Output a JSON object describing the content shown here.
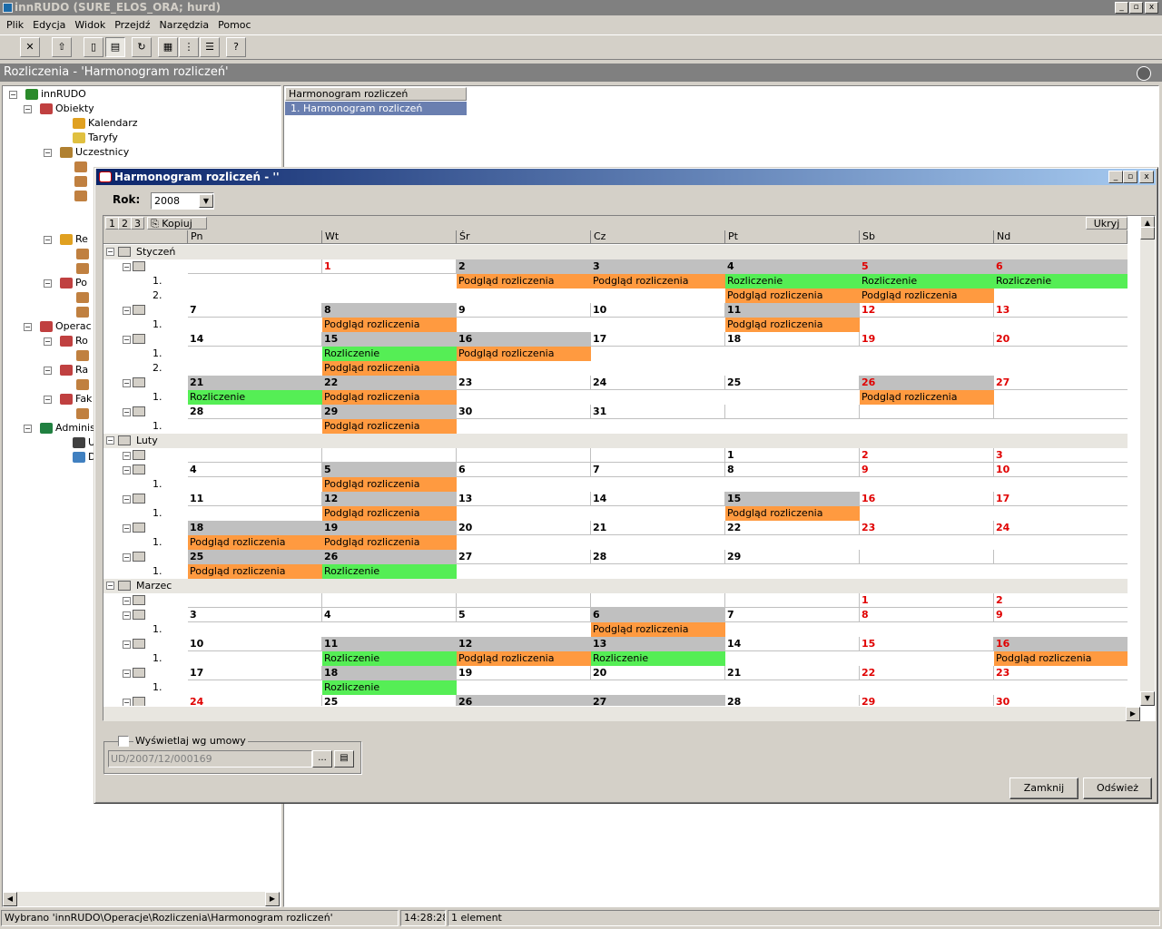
{
  "app": {
    "title": "innRUDO (SURE_ELOS_ORA; hurd)",
    "menu": [
      "Plik",
      "Edycja",
      "Widok",
      "Przejdź",
      "Narzędzia",
      "Pomoc"
    ],
    "section_title": "Rozliczenia - 'Harmonogram rozliczeń'",
    "window_controls": [
      "_",
      "▫",
      "x"
    ]
  },
  "tree": {
    "root": "innRUDO",
    "nodes": [
      {
        "label": "Obiekty",
        "icon": "objects-icon"
      },
      {
        "label": "Kalendarz",
        "icon": "calendar-icon"
      },
      {
        "label": "Taryfy",
        "icon": "tariff-icon"
      },
      {
        "label": "Uczestnicy",
        "icon": "participants-icon"
      },
      {
        "label": "Re",
        "icon": "folder-icon"
      },
      {
        "label": "Po",
        "icon": "folder-icon"
      },
      {
        "label": "Operac",
        "icon": "operations-icon"
      },
      {
        "label": "Ro",
        "icon": "settlement-icon"
      },
      {
        "label": "Ra",
        "icon": "report-icon"
      },
      {
        "label": "Fak",
        "icon": "invoice-icon"
      },
      {
        "label": "Adminis",
        "icon": "admin-icon"
      },
      {
        "label": "Uż",
        "icon": "users-icon"
      },
      {
        "label": "Dzi",
        "icon": "log-icon"
      }
    ]
  },
  "right_list": {
    "header": "Harmonogram rozliczeń",
    "row": "1.  Harmonogram rozliczeń"
  },
  "dialog": {
    "title": "Harmonogram rozliczeń - ''",
    "rok_label": "Rok:",
    "rok_value": "2008",
    "toolbar": [
      "1",
      "2",
      "3",
      "Kopiuj"
    ],
    "hide_label": "Ukryj",
    "columns": [
      "Pn",
      "Wt",
      "Śr",
      "Cz",
      "Pt",
      "Sb",
      "Nd"
    ],
    "show_by_contract": "Wyświetlaj wg umowy",
    "contract_value": "UD/2007/12/000169",
    "browse_label": "...",
    "close_label": "Zamknij",
    "refresh_label": "Odśwież"
  },
  "calendar": {
    "months": [
      {
        "name": "Styczeń",
        "weeks": [
          {
            "days": [
              "",
              "1",
              "2",
              "3",
              "4",
              "5",
              "6"
            ],
            "gray": [
              2,
              3,
              4,
              5,
              6
            ],
            "red": [
              1,
              5,
              6
            ],
            "entries": [
              [
                "",
                "",
                "Podgląd rozliczenia",
                "Podgląd rozliczenia",
                "Rozliczenie",
                "Rozliczenie",
                "Rozliczenie"
              ],
              [
                "",
                "",
                "",
                "",
                "Podgląd rozliczenia",
                "Podgląd rozliczenia",
                ""
              ]
            ]
          },
          {
            "days": [
              "7",
              "8",
              "9",
              "10",
              "11",
              "12",
              "13"
            ],
            "gray": [
              1,
              4
            ],
            "red": [
              5,
              6
            ],
            "entries": [
              [
                "",
                "Podgląd rozliczenia",
                "",
                "",
                "Podgląd rozliczenia",
                "",
                ""
              ]
            ]
          },
          {
            "days": [
              "14",
              "15",
              "16",
              "17",
              "18",
              "19",
              "20"
            ],
            "gray": [
              1,
              2
            ],
            "red": [
              5,
              6
            ],
            "entries": [
              [
                "",
                "Rozliczenie",
                "Podgląd rozliczenia",
                "",
                "",
                "",
                ""
              ],
              [
                "",
                "Podgląd rozliczenia",
                "",
                "",
                "",
                "",
                ""
              ]
            ]
          },
          {
            "days": [
              "21",
              "22",
              "23",
              "24",
              "25",
              "26",
              "27"
            ],
            "gray": [
              0,
              1,
              5
            ],
            "red": [
              5,
              6
            ],
            "entries": [
              [
                "Rozliczenie",
                "Podgląd rozliczenia",
                "",
                "",
                "",
                "Podgląd rozliczenia",
                ""
              ]
            ]
          },
          {
            "days": [
              "28",
              "29",
              "30",
              "31",
              "",
              "",
              ""
            ],
            "gray": [
              1
            ],
            "red": [],
            "entries": [
              [
                "",
                "Podgląd rozliczenia",
                "",
                "",
                "",
                "",
                ""
              ]
            ]
          }
        ]
      },
      {
        "name": "Luty",
        "weeks": [
          {
            "days": [
              "",
              "",
              "",
              "",
              "1",
              "2",
              "3"
            ],
            "gray": [],
            "red": [
              5,
              6
            ],
            "entries": []
          },
          {
            "days": [
              "4",
              "5",
              "6",
              "7",
              "8",
              "9",
              "10"
            ],
            "gray": [
              1
            ],
            "red": [
              5,
              6
            ],
            "entries": [
              [
                "",
                "Podgląd rozliczenia",
                "",
                "",
                "",
                "",
                ""
              ]
            ]
          },
          {
            "days": [
              "11",
              "12",
              "13",
              "14",
              "15",
              "16",
              "17"
            ],
            "gray": [
              1,
              4
            ],
            "red": [
              5,
              6
            ],
            "entries": [
              [
                "",
                "Podgląd rozliczenia",
                "",
                "",
                "Podgląd rozliczenia",
                "",
                ""
              ]
            ]
          },
          {
            "days": [
              "18",
              "19",
              "20",
              "21",
              "22",
              "23",
              "24"
            ],
            "gray": [
              0,
              1
            ],
            "red": [
              5,
              6
            ],
            "entries": [
              [
                "Podgląd rozliczenia",
                "Podgląd rozliczenia",
                "",
                "",
                "",
                "",
                ""
              ]
            ]
          },
          {
            "days": [
              "25",
              "26",
              "27",
              "28",
              "29",
              "",
              ""
            ],
            "gray": [
              0,
              1
            ],
            "red": [],
            "entries": [
              [
                "Podgląd rozliczenia",
                "Rozliczenie",
                "",
                "",
                "",
                "",
                ""
              ]
            ]
          }
        ]
      },
      {
        "name": "Marzec",
        "weeks": [
          {
            "days": [
              "",
              "",
              "",
              "",
              "",
              "1",
              "2"
            ],
            "gray": [],
            "red": [
              5,
              6
            ],
            "entries": []
          },
          {
            "days": [
              "3",
              "4",
              "5",
              "6",
              "7",
              "8",
              "9"
            ],
            "gray": [
              3
            ],
            "red": [
              5,
              6
            ],
            "entries": [
              [
                "",
                "",
                "",
                "Podgląd rozliczenia",
                "",
                "",
                ""
              ]
            ]
          },
          {
            "days": [
              "10",
              "11",
              "12",
              "13",
              "14",
              "15",
              "16"
            ],
            "gray": [
              1,
              2,
              3,
              6
            ],
            "red": [
              5,
              6
            ],
            "entries": [
              [
                "",
                "Rozliczenie",
                "Podgląd rozliczenia",
                "Rozliczenie",
                "",
                "",
                "Podgląd rozliczenia"
              ]
            ]
          },
          {
            "days": [
              "17",
              "18",
              "19",
              "20",
              "21",
              "22",
              "23"
            ],
            "gray": [
              1
            ],
            "red": [
              5,
              6
            ],
            "entries": [
              [
                "",
                "Rozliczenie",
                "",
                "",
                "",
                "",
                ""
              ]
            ]
          },
          {
            "days": [
              "24",
              "25",
              "26",
              "27",
              "28",
              "29",
              "30"
            ],
            "gray": [
              2,
              3
            ],
            "red": [
              0,
              5,
              6
            ],
            "entries": []
          }
        ]
      }
    ]
  },
  "status": {
    "path": "Wybrano 'innRUDO\\Operacje\\Rozliczenia\\Harmonogram rozliczeń'",
    "time": "14:28:28",
    "count": "1 element"
  },
  "colors": {
    "orange": "#ff9a40",
    "green": "#55ee55",
    "red": "#e00000",
    "gray": "#c0c0c0"
  }
}
